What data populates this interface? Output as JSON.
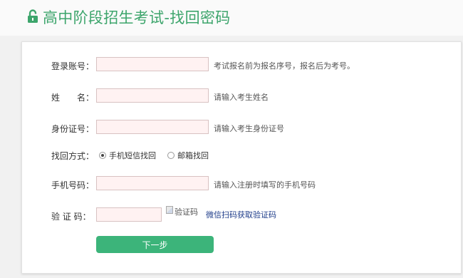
{
  "header": {
    "title": "高中阶段招生考试-找回密码",
    "accent_color": "#3da56c",
    "icon": "unlock-icon"
  },
  "form": {
    "account": {
      "label": "登录账号：",
      "value": "",
      "hint": "考试报名前为报名序号，报名后为考号。"
    },
    "name": {
      "label": "姓　　名：",
      "value": "",
      "hint": "请输入考生姓名"
    },
    "id_number": {
      "label": "身份证号：",
      "value": "",
      "hint": "请输入考生身份证号"
    },
    "recovery": {
      "label": "找回方式：",
      "options": [
        {
          "label": "手机短信找回",
          "selected": true
        },
        {
          "label": "邮箱找回",
          "selected": false
        }
      ]
    },
    "phone": {
      "label": "手机号码：",
      "value": "",
      "hint": "请输入注册时填写的手机号码"
    },
    "captcha": {
      "label": "验 证 码：",
      "value": "",
      "image_alt": "验证码",
      "link": "微信扫码获取验证码"
    },
    "next_button": "下一步"
  }
}
